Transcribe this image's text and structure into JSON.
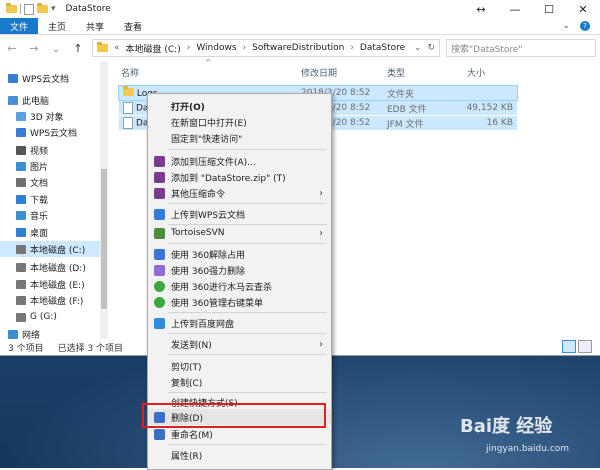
{
  "window": {
    "title": "DataStore",
    "controls": {
      "minimize": "—",
      "maximize": "☐",
      "close": "✕",
      "resize_hint": "↔"
    }
  },
  "ribbon": {
    "tabs": [
      "文件",
      "主页",
      "共享",
      "查看"
    ],
    "expand": "⌄",
    "help": "?"
  },
  "address": {
    "back": "←",
    "forward": "→",
    "up_menu": "⌄",
    "up": "↑",
    "overflow": "«",
    "crumbs": [
      "本地磁盘 (C:)",
      "Windows",
      "SoftwareDistribution",
      "DataStore"
    ],
    "dropdown": "⌄",
    "refresh": "↻",
    "search_placeholder": "搜索\"DataStore\""
  },
  "sidebar": {
    "items": [
      {
        "label": "WPS云文档",
        "icon": "cloud-icon",
        "color": "#3a7bd5"
      },
      {
        "label": "此电脑",
        "icon": "computer-icon",
        "color": "#4a90d9"
      },
      {
        "label": "3D 对象",
        "icon": "cube-icon",
        "color": "#5aa0e0"
      },
      {
        "label": "WPS云文档",
        "icon": "cloud-icon",
        "color": "#3a7bd5"
      },
      {
        "label": "视频",
        "icon": "video-icon",
        "color": "#555555"
      },
      {
        "label": "图片",
        "icon": "picture-icon",
        "color": "#3f8ed0"
      },
      {
        "label": "文档",
        "icon": "document-icon",
        "color": "#6f6f6f"
      },
      {
        "label": "下载",
        "icon": "download-icon",
        "color": "#2f80d0"
      },
      {
        "label": "音乐",
        "icon": "music-icon",
        "color": "#3f8ed0"
      },
      {
        "label": "桌面",
        "icon": "desktop-icon",
        "color": "#2f80d0"
      },
      {
        "label": "本地磁盘 (C:)",
        "icon": "drive-icon",
        "color": "#777777"
      },
      {
        "label": "本地磁盘 (D:)",
        "icon": "drive-icon",
        "color": "#777777"
      },
      {
        "label": "本地磁盘 (E:)",
        "icon": "drive-icon",
        "color": "#777777"
      },
      {
        "label": "本地磁盘 (F:)",
        "icon": "drive-icon",
        "color": "#777777"
      },
      {
        "label": "G (G:)",
        "icon": "drive-icon",
        "color": "#777777"
      },
      {
        "label": "网络",
        "icon": "network-icon",
        "color": "#3f8ed0"
      }
    ]
  },
  "file_list": {
    "sort_indicator": "^",
    "columns": [
      "名称",
      "修改日期",
      "类型",
      "大小"
    ],
    "rows": [
      {
        "name": "Logs",
        "date": "2018/3/20 8:52",
        "type": "文件夹",
        "size": ""
      },
      {
        "name": "Da",
        "date": "2018/3/20 8:52",
        "type": "EDB 文件",
        "size": "49,152 KB"
      },
      {
        "name": "Da",
        "date": "2018/3/20 8:52",
        "type": "JFM 文件",
        "size": "16 KB"
      }
    ]
  },
  "status": {
    "count": "3 个项目",
    "selected": "已选择 3 个项目"
  },
  "context_menu": {
    "items": [
      {
        "label": "打开(O)",
        "bold": true
      },
      {
        "label": "在新窗口中打开(E)"
      },
      {
        "label": "固定到\"快速访问\""
      },
      {
        "label": "添加到压缩文件(A)...",
        "icon": "winrar-icon",
        "color": "#7a3b8c"
      },
      {
        "label": "添加到 \"DataStore.zip\" (T)",
        "icon": "winrar-icon",
        "color": "#7a3b8c"
      },
      {
        "label": "其他压缩命令",
        "icon": "winrar-icon",
        "color": "#7a3b8c",
        "sub": "›"
      },
      {
        "label": "上传到WPS云文档",
        "icon": "wps-cloud-icon",
        "color": "#2f7ed8"
      },
      {
        "label": "TortoiseSVN",
        "icon": "tortoise-icon",
        "color": "#4c8c3a",
        "sub": "›"
      },
      {
        "label": "使用 360解除占用",
        "icon": "unlock-360-icon",
        "color": "#3a74d6"
      },
      {
        "label": "使用 360强力删除",
        "icon": "delete-360-icon",
        "color": "#8f6ad8"
      },
      {
        "label": "使用 360进行木马云查杀",
        "icon": "scan-360-icon",
        "color": "#3aa83a"
      },
      {
        "label": "使用 360管理右键菜单",
        "icon": "menu-360-icon",
        "color": "#3aa83a"
      },
      {
        "label": "上传到百度网盘",
        "icon": "baidu-cloud-icon",
        "color": "#2e8cd8"
      },
      {
        "label": "发送到(N)",
        "sub": "›"
      },
      {
        "label": "剪切(T)"
      },
      {
        "label": "复制(C)"
      },
      {
        "label": "创建快捷方式(S)"
      },
      {
        "label": "删除(D)",
        "icon": "shield-icon",
        "color": "#3b6fc6",
        "highlight": true
      },
      {
        "label": "重命名(M)",
        "icon": "shield-icon",
        "color": "#3b6fc6"
      },
      {
        "label": "属性(R)"
      }
    ]
  },
  "watermark": {
    "brand": "Bai度 经验",
    "url": "jingyan.baidu.com"
  },
  "colors": {
    "accent": "#1979ca",
    "selection": "#cce8ff",
    "highlight_box": "#e0201c"
  }
}
